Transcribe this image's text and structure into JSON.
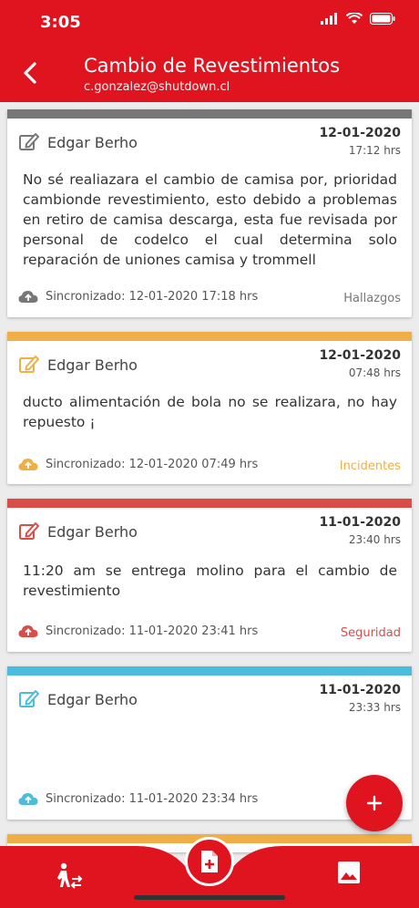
{
  "status": {
    "time": "3:05"
  },
  "header": {
    "title": "Cambio de Revestimientos",
    "subtitle": "c.gonzalez@shutdown.cl"
  },
  "colors": {
    "primary": "#e0141f",
    "gray": "#777777",
    "orange": "#f0ae47",
    "red": "#d94c48",
    "blue": "#4bbcdc"
  },
  "cards": [
    {
      "author": "Edgar Berho",
      "date": "12-01-2020",
      "time": "17:12 hrs",
      "body": "No sé realiazara el cambio de camisa por, prioridad cambionde revestimiento, esto debido a problemas en retiro de camisa descarga, esta fue revisada por personal de codelco el cual determina solo reparación de uniones camisa y trommell",
      "sync": "Sincronizado: 12-01-2020 17:18 hrs",
      "category": "Hallazgos"
    },
    {
      "author": "Edgar Berho",
      "date": "12-01-2020",
      "time": "07:48 hrs",
      "body": "ducto alimentación de bola no se realizara,  no hay repuesto ¡",
      "sync": "Sincronizado: 12-01-2020 07:49 hrs",
      "category": "Incidentes"
    },
    {
      "author": "Edgar Berho",
      "date": "11-01-2020",
      "time": "23:40 hrs",
      "body": "11:20 am se entrega molino para el cambio de revestimiento",
      "sync": "Sincronizado: 11-01-2020 23:41 hrs",
      "category": "Seguridad"
    },
    {
      "author": "Edgar Berho",
      "date": "11-01-2020",
      "time": "23:33 hrs",
      "body": "",
      "sync": "Sincronizado: 11-01-2020 23:34 hrs",
      "category": ""
    }
  ],
  "icons": {
    "back": "chevron-left-icon",
    "edit": "edit-icon",
    "cloud": "cloud-upload-icon",
    "fab": "plus-icon",
    "nav_left": "person-transfer-icon",
    "nav_center": "add-document-icon",
    "nav_right": "image-icon"
  }
}
